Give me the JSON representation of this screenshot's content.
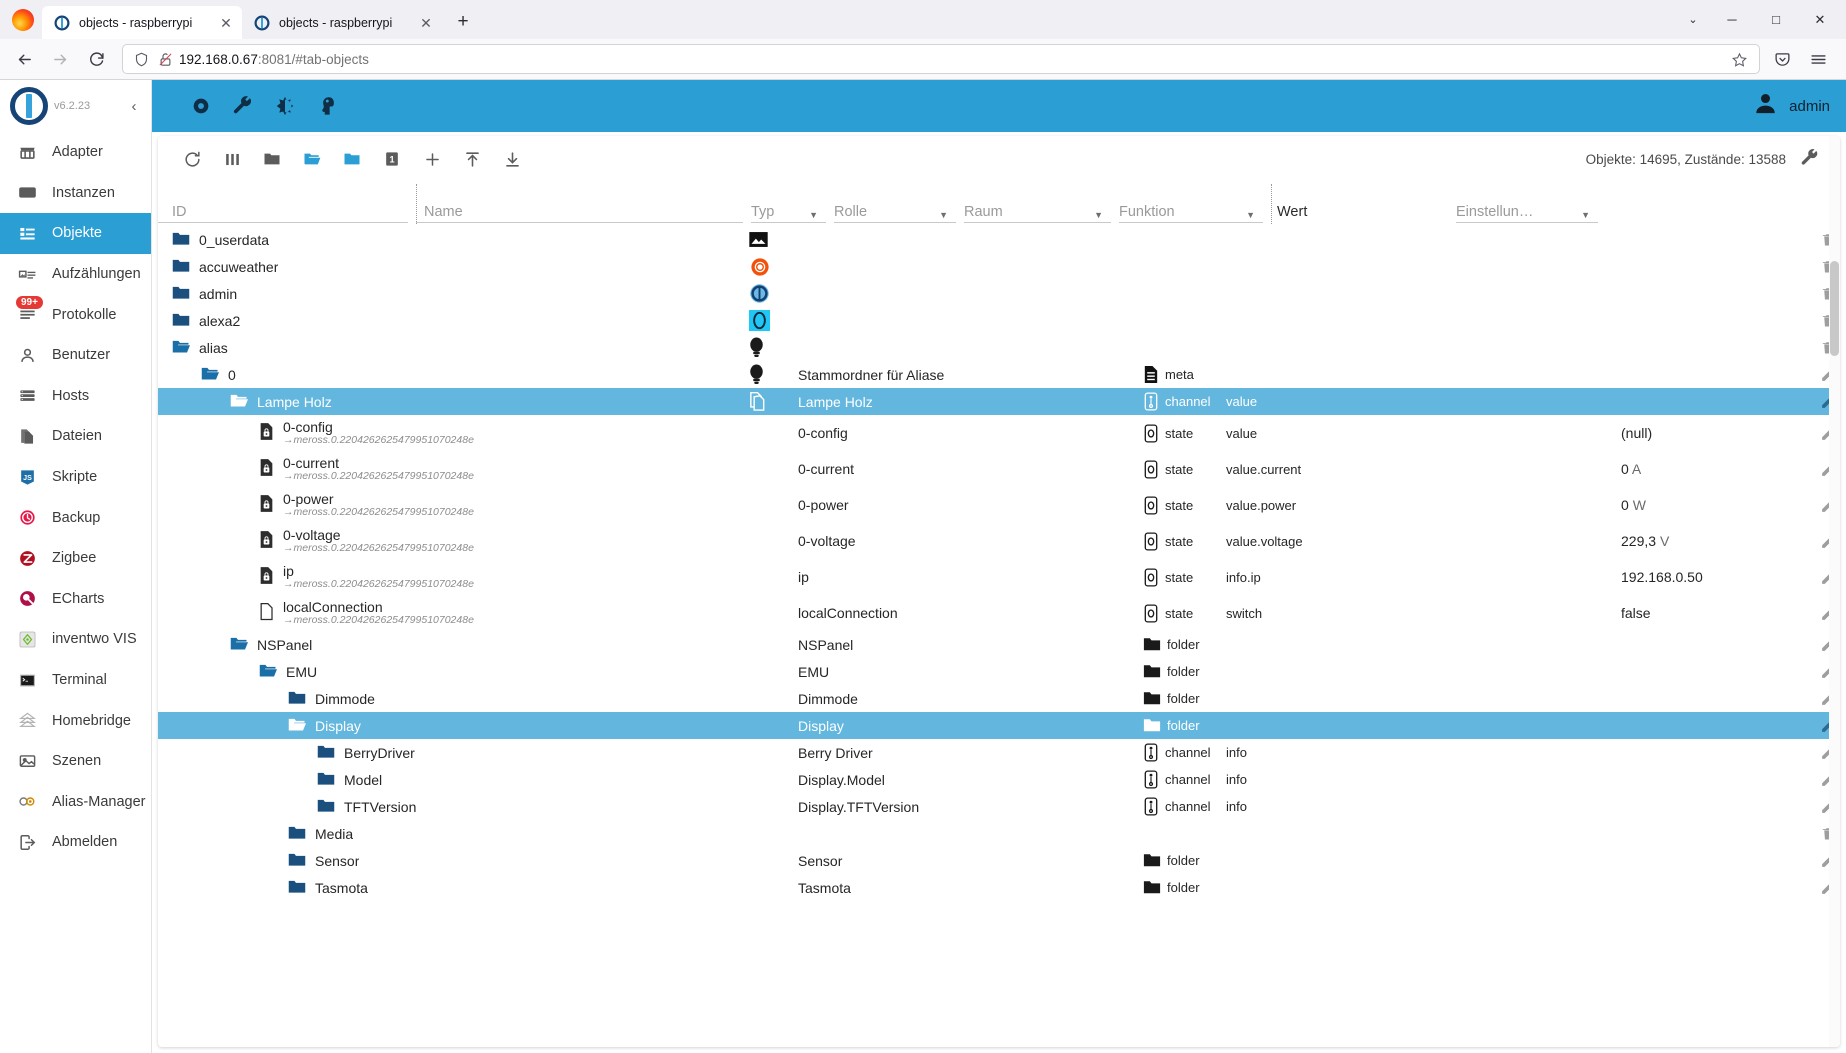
{
  "browser": {
    "tabs": [
      {
        "title": "objects - raspberrypi",
        "favicon": "iobroker-icon",
        "close": "✕",
        "active": true
      },
      {
        "title": "objects - raspberrypi",
        "favicon": "iobroker-icon",
        "close": "✕",
        "active": false
      }
    ],
    "new_tab_label": "+",
    "window_controls": {
      "list_all_tabs": "⌄",
      "minimize": "─",
      "maximize": "□",
      "close": "✕"
    },
    "nav": {
      "back": "←",
      "forward": "→",
      "reload": "⟳"
    },
    "url": {
      "host": "192.168.0.67",
      "rest": ":8081/#tab-objects",
      "shield_icon": "shield-icon",
      "permission_icon": "broken-lock-icon",
      "bookmark_icon": "star-icon"
    },
    "toolbar_right": {
      "pocket": "save-to-pocket-icon",
      "menu": "application-menu-icon"
    }
  },
  "sidebar": {
    "version": "v6.2.23",
    "collapse": "‹",
    "items": [
      {
        "label": "Adapter",
        "icon": "store-icon",
        "selected": false
      },
      {
        "label": "Instanzen",
        "icon": "instances-icon",
        "selected": false
      },
      {
        "label": "Objekte",
        "icon": "list-icon",
        "selected": true
      },
      {
        "label": "Aufzählungen",
        "icon": "enums-icon",
        "selected": false
      },
      {
        "label": "Protokolle",
        "icon": "logs-icon",
        "selected": false,
        "badge": "99+"
      },
      {
        "label": "Benutzer",
        "icon": "user-icon",
        "selected": false
      },
      {
        "label": "Hosts",
        "icon": "hosts-icon",
        "selected": false
      },
      {
        "label": "Dateien",
        "icon": "files-icon",
        "selected": false
      },
      {
        "label": "Skripte",
        "icon": "javascript-icon",
        "selected": false
      },
      {
        "label": "Backup",
        "icon": "backup-clock-icon",
        "selected": false
      },
      {
        "label": "Zigbee",
        "icon": "zigbee-icon",
        "selected": false
      },
      {
        "label": "ECharts",
        "icon": "echarts-icon",
        "selected": false
      },
      {
        "label": "inventwo VIS",
        "icon": "inventwo-vis-icon",
        "selected": false
      },
      {
        "label": "Terminal",
        "icon": "terminal-icon",
        "selected": false
      },
      {
        "label": "Homebridge",
        "icon": "homebridge-icon",
        "selected": false
      },
      {
        "label": "Szenen",
        "icon": "scenes-icon",
        "selected": false
      },
      {
        "label": "Alias-Manager",
        "icon": "alias-manager-icon",
        "selected": false
      },
      {
        "label": "Abmelden",
        "icon": "logout-icon",
        "selected": false
      }
    ]
  },
  "appbar": {
    "icons": [
      "eye-icon",
      "wrench-icon",
      "contrast-icon",
      "expert-mode-icon"
    ],
    "user": "admin",
    "avatar": "avatar-icon"
  },
  "toolbar": {
    "buttons": [
      {
        "name": "refresh-icon",
        "label": "⟳"
      },
      {
        "name": "columns-icon",
        "label": "‖"
      },
      {
        "name": "collapse-all-icon",
        "label": "folder"
      },
      {
        "name": "expand-all-icon",
        "label": "folder-open"
      },
      {
        "name": "expand-one-level-icon",
        "label": "folder-blue"
      },
      {
        "name": "depth-level-icon",
        "label": "1"
      },
      {
        "name": "add-object-icon",
        "label": "+"
      },
      {
        "name": "import-icon",
        "label": "↑"
      },
      {
        "name": "export-icon",
        "label": "↓"
      }
    ],
    "counts": "Objekte: 14695, Zustände: 13588",
    "settings_icon": "wrench-icon"
  },
  "columns": {
    "id": "ID",
    "name": "Name",
    "type": "Typ",
    "role": "Rolle",
    "room": "Raum",
    "function": "Funktion",
    "value": "Wert",
    "settings": "Einstellun…"
  },
  "tree": [
    {
      "indent": 0,
      "id": "0_userdata",
      "icon": "folder-closed",
      "adapter_icon": "image-icon",
      "name": "",
      "type": "",
      "role": "",
      "value": "",
      "actions": [
        "delete"
      ],
      "selected": false
    },
    {
      "indent": 0,
      "id": "accuweather",
      "icon": "folder-closed",
      "adapter_icon": "accuweather-icon",
      "name": "",
      "type": "",
      "role": "",
      "value": "",
      "actions": [
        "delete"
      ],
      "selected": false
    },
    {
      "indent": 0,
      "id": "admin",
      "icon": "folder-closed",
      "adapter_icon": "admin-icon",
      "name": "",
      "type": "",
      "role": "",
      "value": "",
      "actions": [
        "delete"
      ],
      "selected": false
    },
    {
      "indent": 0,
      "id": "alexa2",
      "icon": "folder-closed",
      "adapter_icon": "alexa2-icon",
      "name": "",
      "type": "",
      "role": "",
      "value": "",
      "actions": [
        "delete"
      ],
      "selected": false
    },
    {
      "indent": 0,
      "id": "alias",
      "icon": "folder-open",
      "adapter_icon": "bulb-icon",
      "name": "",
      "type": "",
      "role": "",
      "value": "",
      "actions": [
        "delete"
      ],
      "selected": false
    },
    {
      "indent": 1,
      "id": "0",
      "icon": "folder-open",
      "adapter_icon": "bulb-icon",
      "name": "Stammordner für Aliase",
      "type": "meta",
      "type_icon": "meta-icon",
      "role": "",
      "value": "",
      "actions": [
        "edit",
        "delete"
      ],
      "selected": false
    },
    {
      "indent": 2,
      "id": "Lampe Holz",
      "icon": "folder-open",
      "adapter_icon": "copy-icon",
      "name": "Lampe Holz",
      "type": "channel",
      "type_icon": "channel-icon",
      "role": "value",
      "value": "",
      "actions": [
        "edit",
        "delete"
      ],
      "selected": true
    },
    {
      "indent": 3,
      "id": "0-config",
      "icon": "doc-lock",
      "sub": "→meross.0.2204262625479951070248e",
      "name": "0-config",
      "type": "state",
      "type_icon": "state-icon",
      "role": "value",
      "value": "(null)",
      "actions": [
        "edit",
        "delete",
        "settings-faint"
      ],
      "selected": false
    },
    {
      "indent": 3,
      "id": "0-current",
      "icon": "doc-lock",
      "sub": "→meross.0.2204262625479951070248e",
      "name": "0-current",
      "type": "state",
      "type_icon": "state-icon",
      "role": "value.current",
      "value": "0 A",
      "value_unit": "A",
      "actions": [
        "edit",
        "delete",
        "settings-faint"
      ],
      "selected": false
    },
    {
      "indent": 3,
      "id": "0-power",
      "icon": "doc-lock",
      "sub": "→meross.0.2204262625479951070248e",
      "name": "0-power",
      "type": "state",
      "type_icon": "state-icon",
      "role": "value.power",
      "value": "0 W",
      "value_unit": "W",
      "actions": [
        "edit",
        "delete",
        "settings-blue"
      ],
      "selected": false
    },
    {
      "indent": 3,
      "id": "0-voltage",
      "icon": "doc-lock",
      "sub": "→meross.0.2204262625479951070248e",
      "name": "0-voltage",
      "type": "state",
      "type_icon": "state-icon",
      "role": "value.voltage",
      "value": "229,3 V",
      "value_unit": "V",
      "actions": [
        "edit",
        "delete",
        "settings-faint"
      ],
      "selected": false
    },
    {
      "indent": 3,
      "id": "ip",
      "icon": "doc-lock",
      "sub": "→meross.0.2204262625479951070248e",
      "name": "ip",
      "type": "state",
      "type_icon": "state-icon",
      "role": "info.ip",
      "value": "192.168.0.50",
      "actions": [
        "edit",
        "delete",
        "settings-faint"
      ],
      "selected": false
    },
    {
      "indent": 3,
      "id": "localConnection",
      "icon": "doc-plain",
      "sub": "→meross.0.2204262625479951070248e",
      "name": "localConnection",
      "type": "state",
      "type_icon": "state-icon",
      "role": "switch",
      "value": "false",
      "actions": [
        "edit",
        "delete",
        "settings-faint"
      ],
      "selected": false
    },
    {
      "indent": 2,
      "id": "NSPanel",
      "icon": "folder-open",
      "name": "NSPanel",
      "type": "folder",
      "type_icon": "folder-icon",
      "role": "",
      "value": "",
      "actions": [
        "edit",
        "delete"
      ],
      "selected": false
    },
    {
      "indent": 3,
      "id": "EMU",
      "icon": "folder-open",
      "name": "EMU",
      "type": "folder",
      "type_icon": "folder-icon",
      "role": "",
      "value": "",
      "actions": [
        "edit",
        "delete"
      ],
      "selected": false
    },
    {
      "indent": 4,
      "id": "Dimmode",
      "icon": "folder-closed",
      "name": "Dimmode",
      "type": "folder",
      "type_icon": "folder-icon",
      "role": "",
      "value": "",
      "actions": [
        "edit",
        "delete"
      ],
      "selected": false
    },
    {
      "indent": 4,
      "id": "Display",
      "icon": "folder-open",
      "name": "Display",
      "type": "folder",
      "type_icon": "folder-icon",
      "role": "",
      "value": "",
      "actions": [
        "edit",
        "delete"
      ],
      "selected": true
    },
    {
      "indent": 5,
      "id": "BerryDriver",
      "icon": "folder-closed",
      "name": "Berry Driver",
      "type": "channel",
      "type_icon": "channel-icon",
      "role": "info",
      "value": "",
      "actions": [
        "edit",
        "delete"
      ],
      "selected": false
    },
    {
      "indent": 5,
      "id": "Model",
      "icon": "folder-closed",
      "name": "Display.Model",
      "type": "channel",
      "type_icon": "channel-icon",
      "role": "info",
      "value": "",
      "actions": [
        "edit",
        "delete"
      ],
      "selected": false
    },
    {
      "indent": 5,
      "id": "TFTVersion",
      "icon": "folder-closed",
      "name": "Display.TFTVersion",
      "type": "channel",
      "type_icon": "channel-icon",
      "role": "info",
      "value": "",
      "actions": [
        "edit",
        "delete"
      ],
      "selected": false
    },
    {
      "indent": 4,
      "id": "Media",
      "icon": "folder-closed",
      "name": "",
      "type": "",
      "role": "",
      "value": "",
      "actions": [
        "delete"
      ],
      "selected": false
    },
    {
      "indent": 4,
      "id": "Sensor",
      "icon": "folder-closed",
      "name": "Sensor",
      "type": "folder",
      "type_icon": "folder-icon",
      "role": "",
      "value": "",
      "actions": [
        "edit",
        "delete"
      ],
      "selected": false
    },
    {
      "indent": 4,
      "id": "Tasmota",
      "icon": "folder-closed",
      "name": "Tasmota",
      "type": "folder",
      "type_icon": "folder-icon",
      "role": "",
      "value": "",
      "actions": [
        "edit",
        "delete"
      ],
      "selected": false
    }
  ],
  "colors": {
    "accent": "#2b9ed4",
    "selection": "#63b6dd",
    "folder": "#1b4f7e",
    "folder_open": "#1b6fa8",
    "badge_red": "#e53935",
    "settings_blue": "#3b6f9e"
  }
}
